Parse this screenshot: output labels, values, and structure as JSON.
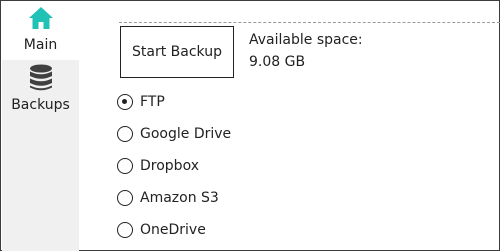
{
  "sidebar": {
    "items": [
      {
        "label": "Main",
        "icon": "home-icon",
        "active": true
      },
      {
        "label": "Backups",
        "icon": "database-icon",
        "active": false
      }
    ]
  },
  "main": {
    "start_backup_label": "Start Backup",
    "available_space_label": "Available space:",
    "available_space_value": "9.08 GB",
    "destinations": [
      {
        "label": "FTP",
        "selected": true
      },
      {
        "label": "Google Drive",
        "selected": false
      },
      {
        "label": "Dropbox",
        "selected": false
      },
      {
        "label": "Amazon S3",
        "selected": false
      },
      {
        "label": "OneDrive",
        "selected": false
      }
    ]
  },
  "colors": {
    "accent": "#1fc2b5",
    "sidebar_bg": "#f0f0f0",
    "icon_dark": "#404040"
  }
}
